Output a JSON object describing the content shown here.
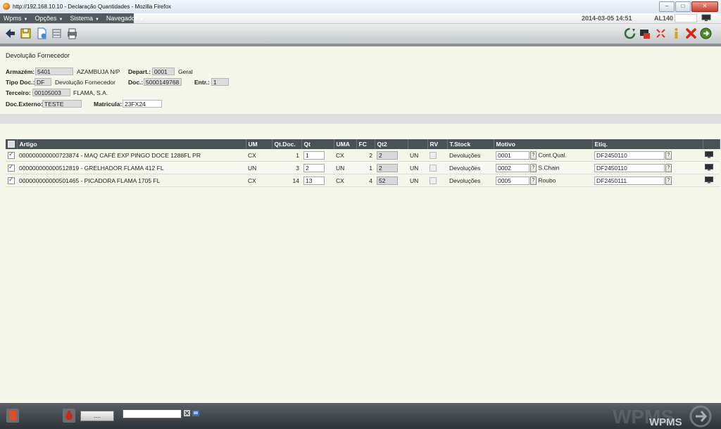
{
  "window": {
    "title": "http://192.168.10.10 - Declaração Quantidades - Mozilla Firefox"
  },
  "menu": {
    "items": [
      "Wpms",
      "Opções",
      "Sistema",
      "Navegador"
    ],
    "datetime": "2014-03-05 14:51",
    "user": "AL140"
  },
  "toolbar": {
    "left_icons": [
      "back-arrow-icon",
      "save-icon",
      "document-icon",
      "grid-icon",
      "print-icon"
    ],
    "right_icons": [
      "refresh-icon",
      "export-icon",
      "shrink-icon",
      "info-icon",
      "close-icon",
      "exit-icon"
    ]
  },
  "page": {
    "title": "Devolução Fornecedor"
  },
  "form": {
    "armazem": {
      "label": "Armazém:",
      "code": "5401",
      "name": "AZAMBUJA N/P"
    },
    "depart": {
      "label": "Depart.:",
      "code": "0001",
      "name": "Geral"
    },
    "tipo_doc": {
      "label": "Tipo Doc.:",
      "code": "DF",
      "name": "Devolução Fornecedor"
    },
    "doc": {
      "label": "Doc.:",
      "value": "5000149768"
    },
    "entr": {
      "label": "Entr.:",
      "value": "1"
    },
    "terceiro": {
      "label": "Terceiro:",
      "code": "00105003",
      "name": "FLAMA, S.A."
    },
    "doc_externo": {
      "label": "Doc.Externo:",
      "value": "TESTE"
    },
    "matricula": {
      "label": "Matricula:",
      "value": "23FX24"
    }
  },
  "table": {
    "headers": {
      "artigo": "Artigo",
      "um": "UM",
      "qt_doc": "Qt.Doc.",
      "qt": "Qt",
      "uma": "UMA",
      "fc": "FC",
      "qt2": "Qt2",
      "rv": "RV",
      "tstock": "T.Stock",
      "motivo": "Motivo",
      "etiq": "Etiq."
    },
    "rows": [
      {
        "artigo": "000000000000723874 - MAQ CAFÉ EXP PINGO DOCE 1288FL PR",
        "um": "CX",
        "qt_doc": "1",
        "qt": "1",
        "uma": "CX",
        "fc": "2",
        "qt2": "2",
        "un": "UN",
        "tstock": "Devoluções",
        "motivo_code": "0001",
        "motivo_desc": "Cont.Qual.",
        "etiq": "DF2450110"
      },
      {
        "artigo": "000000000000512819 - GRELHADOR FLAMA 412 FL",
        "um": "UN",
        "qt_doc": "3",
        "qt": "2",
        "uma": "UN",
        "fc": "1",
        "qt2": "2",
        "un": "UN",
        "tstock": "Devoluções",
        "motivo_code": "0002",
        "motivo_desc": "S.Chain",
        "etiq": "DF2450110"
      },
      {
        "artigo": "000000000000501465 - PICADORA FLAMA 1705 FL",
        "um": "CX",
        "qt_doc": "14",
        "qt": "13",
        "uma": "CX",
        "fc": "4",
        "qt2": "52",
        "un": "UN",
        "tstock": "Devoluções",
        "motivo_code": "0005",
        "motivo_desc": "Roubo",
        "etiq": "DF2450111"
      }
    ]
  },
  "footer": {
    "button_label": "....",
    "brand": "WPMS"
  },
  "colors": {
    "header_bg": "#4a5157",
    "page_bg": "#f4f6ea",
    "menu_bg": "#52595f",
    "close_red": "#cc2a1a"
  }
}
